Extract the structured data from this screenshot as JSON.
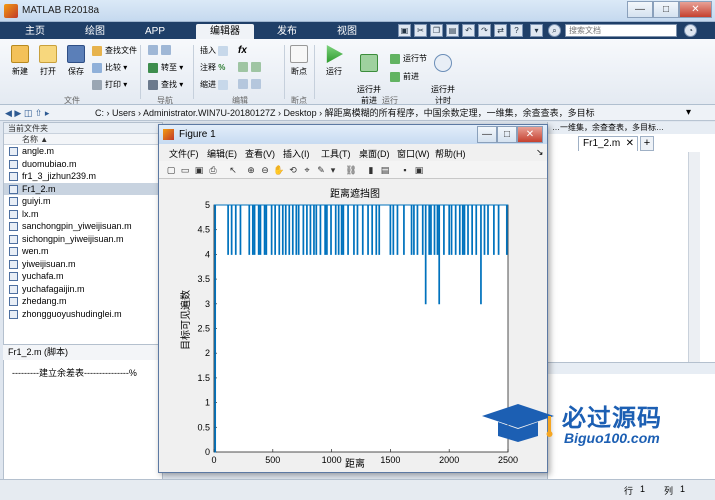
{
  "window": {
    "title": "MATLAB R2018a",
    "min": "—",
    "max": "□",
    "close": "✕"
  },
  "tabs": [
    {
      "label": "主页"
    },
    {
      "label": "绘图"
    },
    {
      "label": "APP"
    },
    {
      "label": "编辑器"
    },
    {
      "label": "发布"
    },
    {
      "label": "视图"
    }
  ],
  "search": {
    "placeholder": "搜索文档"
  },
  "ribbon": {
    "new": "新建",
    "open": "打开",
    "save": "保存",
    "find_files": "查找文件",
    "compare": "比较",
    "print": "打印",
    "goto": "转至",
    "find": "查找",
    "insert": "插入",
    "fx": "fx",
    "comment": "注释",
    "indent": "缩进",
    "breakpoints": "断点",
    "run": "运行",
    "run_advance": "运行并\n前进",
    "run_section": "运行节",
    "advance": "前进",
    "run_time": "运行并\n计时",
    "groups": {
      "file": "文件",
      "nav": "导航",
      "edit": "编辑",
      "bp": "断点",
      "run": "运行"
    }
  },
  "address": {
    "path": "C: › Users › Administrator.WIN7U-20180127Z › Desktop › 解距离模糊的所有程序，中国余数定理，一维集，余查查表，多目标"
  },
  "left_panel": {
    "title": "当前文件夹",
    "col_name": "名称 ▲",
    "files": [
      "angle.m",
      "duomubiao.m",
      "fr1_3_jizhun239.m",
      "Fr1_2.m",
      "guiyi.m",
      "lx.m",
      "sanchongpin_yiweijisuan.m",
      "sichongpin_yiweijisuan.m",
      "wen.m",
      "yiweijisuan.m",
      "yuchafa.m",
      "yuchafagaijin.m",
      "zhedang.m",
      "zhongguoyushudinglei.m"
    ],
    "selected": 3,
    "details": "Fr1_2.m  (脚本)"
  },
  "cmd": {
    "text": "---------建立余差表---------------%"
  },
  "editor": {
    "header": "…一维集，余查查表，多目标…",
    "tab": "Fr1_2.m",
    "add": "+"
  },
  "figure": {
    "title": "Figure 1",
    "menu": [
      "文件(F)",
      "编辑(E)",
      "查看(V)",
      "插入(I)",
      "工具(T)",
      "桌面(D)",
      "窗口(W)",
      "帮助(H)"
    ]
  },
  "chart_data": {
    "type": "line",
    "title": "距离遮挡图",
    "xlabel": "距离",
    "ylabel": "目标可见遍数",
    "xlim": [
      0,
      2500
    ],
    "ylim": [
      0,
      5
    ],
    "xticks": [
      0,
      500,
      1000,
      1500,
      2000,
      2500
    ],
    "yticks": [
      0,
      0.5,
      1,
      1.5,
      2,
      2.5,
      3,
      3.5,
      4,
      4.5,
      5
    ],
    "series": [
      {
        "values_note": "",
        "color": "#0072bd"
      }
    ],
    "dips": [
      [
        10,
        0
      ],
      [
        120,
        4
      ],
      [
        150,
        4
      ],
      [
        185,
        4
      ],
      [
        225,
        4
      ],
      [
        300,
        4
      ],
      [
        330,
        4
      ],
      [
        345,
        4
      ],
      [
        380,
        4
      ],
      [
        395,
        4
      ],
      [
        430,
        4
      ],
      [
        445,
        4
      ],
      [
        490,
        4
      ],
      [
        520,
        4
      ],
      [
        555,
        4
      ],
      [
        585,
        4
      ],
      [
        610,
        4
      ],
      [
        640,
        4
      ],
      [
        670,
        4
      ],
      [
        700,
        4
      ],
      [
        720,
        4
      ],
      [
        760,
        4
      ],
      [
        790,
        4
      ],
      [
        820,
        4
      ],
      [
        850,
        4
      ],
      [
        870,
        4
      ],
      [
        905,
        4
      ],
      [
        945,
        4
      ],
      [
        960,
        4
      ],
      [
        995,
        4
      ],
      [
        1035,
        4
      ],
      [
        1060,
        4
      ],
      [
        1085,
        4
      ],
      [
        1100,
        4
      ],
      [
        1140,
        4
      ],
      [
        1190,
        4
      ],
      [
        1220,
        4
      ],
      [
        1265,
        4
      ],
      [
        1310,
        4
      ],
      [
        1345,
        4
      ],
      [
        1380,
        4
      ],
      [
        1405,
        4
      ],
      [
        1500,
        4
      ],
      [
        1525,
        4
      ],
      [
        1560,
        4
      ],
      [
        1615,
        4
      ],
      [
        1680,
        4
      ],
      [
        1700,
        4
      ],
      [
        1730,
        4
      ],
      [
        1775,
        4
      ],
      [
        1800,
        3
      ],
      [
        1830,
        4
      ],
      [
        1845,
        4
      ],
      [
        1875,
        4
      ],
      [
        1900,
        4
      ],
      [
        1915,
        3
      ],
      [
        1955,
        4
      ],
      [
        2000,
        4
      ],
      [
        2020,
        4
      ],
      [
        2055,
        4
      ],
      [
        2090,
        4
      ],
      [
        2115,
        4
      ],
      [
        2130,
        4
      ],
      [
        2160,
        4
      ],
      [
        2195,
        4
      ],
      [
        2230,
        4
      ],
      [
        2270,
        3
      ],
      [
        2300,
        4
      ],
      [
        2330,
        4
      ],
      [
        2380,
        4
      ],
      [
        2420,
        4
      ],
      [
        2490,
        4
      ]
    ],
    "baseline": 5
  },
  "status": {
    "line_label": "行",
    "line": "1",
    "col_label": "列",
    "col": "1"
  },
  "watermark": {
    "brand": "必过源码",
    "site": "Biguo100.com"
  },
  "colors": {
    "tabbar": "#1f3f68",
    "accent": "#0072bd",
    "watermark": "#1c5fb3"
  }
}
